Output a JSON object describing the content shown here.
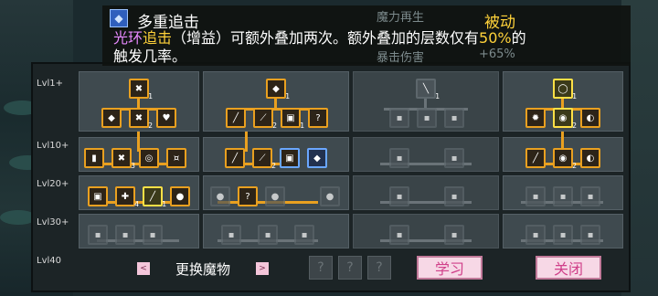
{
  "tooltip": {
    "title": "多重追击",
    "passive_tag": "被动",
    "desc_prefix": "光环",
    "desc_highlight1": "追击",
    "desc_mid": "（增益）可额外叠加两次。额外叠加的层数仅有",
    "desc_highlight2": "50%",
    "desc_end": "的",
    "desc_line2": "触发几率。",
    "ghost_texts": [
      "魔力再生",
      "暴击伤害",
      "+65%"
    ]
  },
  "tree": {
    "row_labels": [
      "Lvl1+",
      "Lvl10+",
      "Lvl20+",
      "Lvl30+",
      "Lvl40"
    ],
    "columns": [
      {
        "name": "column-1",
        "state": "active"
      },
      {
        "name": "column-2",
        "state": "active-blue"
      },
      {
        "name": "column-3",
        "state": "locked"
      },
      {
        "name": "column-4",
        "state": "active-green"
      }
    ]
  },
  "controls": {
    "prev_arrow": "<",
    "swap_label": "更换魔物",
    "next_arrow": ">",
    "empty_slot": "?",
    "learn_button": "学习",
    "close_button": "关闭"
  },
  "icons": {
    "tooltip_icon": "chase-skill-icon"
  },
  "colors": {
    "active_border": "#e9a020",
    "selected_border": "#ffe046",
    "passive_text": "#ffd23a",
    "button_text": "#d0408a"
  }
}
